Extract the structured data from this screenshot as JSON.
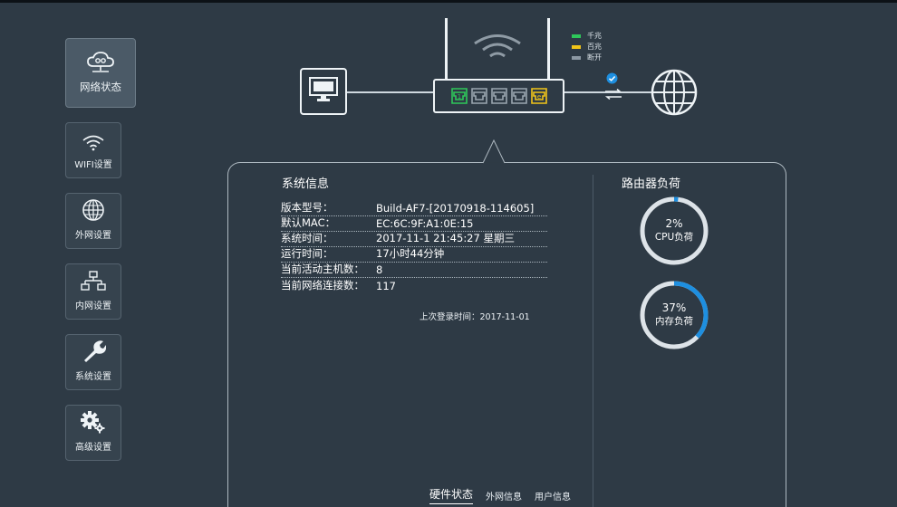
{
  "sidebar": {
    "items": [
      {
        "label": "网络状态",
        "icon": "cloud-network-icon",
        "active": true
      },
      {
        "label": "WIFI设置",
        "icon": "wifi-icon",
        "active": false
      },
      {
        "label": "外网设置",
        "icon": "globe-icon",
        "active": false
      },
      {
        "label": "内网设置",
        "icon": "lan-topology-icon",
        "active": false
      },
      {
        "label": "系统设置",
        "icon": "wrench-icon",
        "active": false
      },
      {
        "label": "高级设置",
        "icon": "gears-icon",
        "active": false
      }
    ]
  },
  "topology": {
    "legend": [
      {
        "label": "千兆",
        "color": "#2ec85a"
      },
      {
        "label": "百兆",
        "color": "#f0c419"
      },
      {
        "label": "断开",
        "color": "#8c98a3"
      }
    ],
    "ports": [
      {
        "label": "1",
        "state": "gigabit"
      },
      {
        "label": "",
        "state": "off"
      },
      {
        "label": "",
        "state": "off"
      },
      {
        "label": "",
        "state": "off"
      },
      {
        "label": "e",
        "state": "fast"
      }
    ],
    "wan_connected": true
  },
  "system_info": {
    "title": "系统信息",
    "rows": [
      {
        "key": "版本型号：",
        "value": "Build-AF7-[20170918-114605]"
      },
      {
        "key": "默认MAC：",
        "value": "EC:6C:9F:A1:0E:15"
      },
      {
        "key": "系统时间：",
        "value": "2017-11-1 21:45:27 星期三"
      },
      {
        "key": "运行时间：",
        "value": "17小时44分钟"
      },
      {
        "key": "当前活动主机数：",
        "value": "8"
      },
      {
        "key": "当前网络连接数：",
        "value": "117"
      }
    ],
    "last_login": "上次登录时间：2017-11-01"
  },
  "load": {
    "title": "路由器负荷",
    "cpu": {
      "percent_label": "2%",
      "name": "CPU负荷",
      "value": 0.02
    },
    "memory": {
      "percent_label": "37%",
      "name": "内存负荷",
      "value": 0.37
    },
    "track_color": "#dde3e8",
    "fill_color": "#1e8fe0"
  },
  "tabs": [
    {
      "label": "硬件状态",
      "active": true
    },
    {
      "label": "外网信息",
      "active": false
    },
    {
      "label": "用户信息",
      "active": false
    }
  ]
}
